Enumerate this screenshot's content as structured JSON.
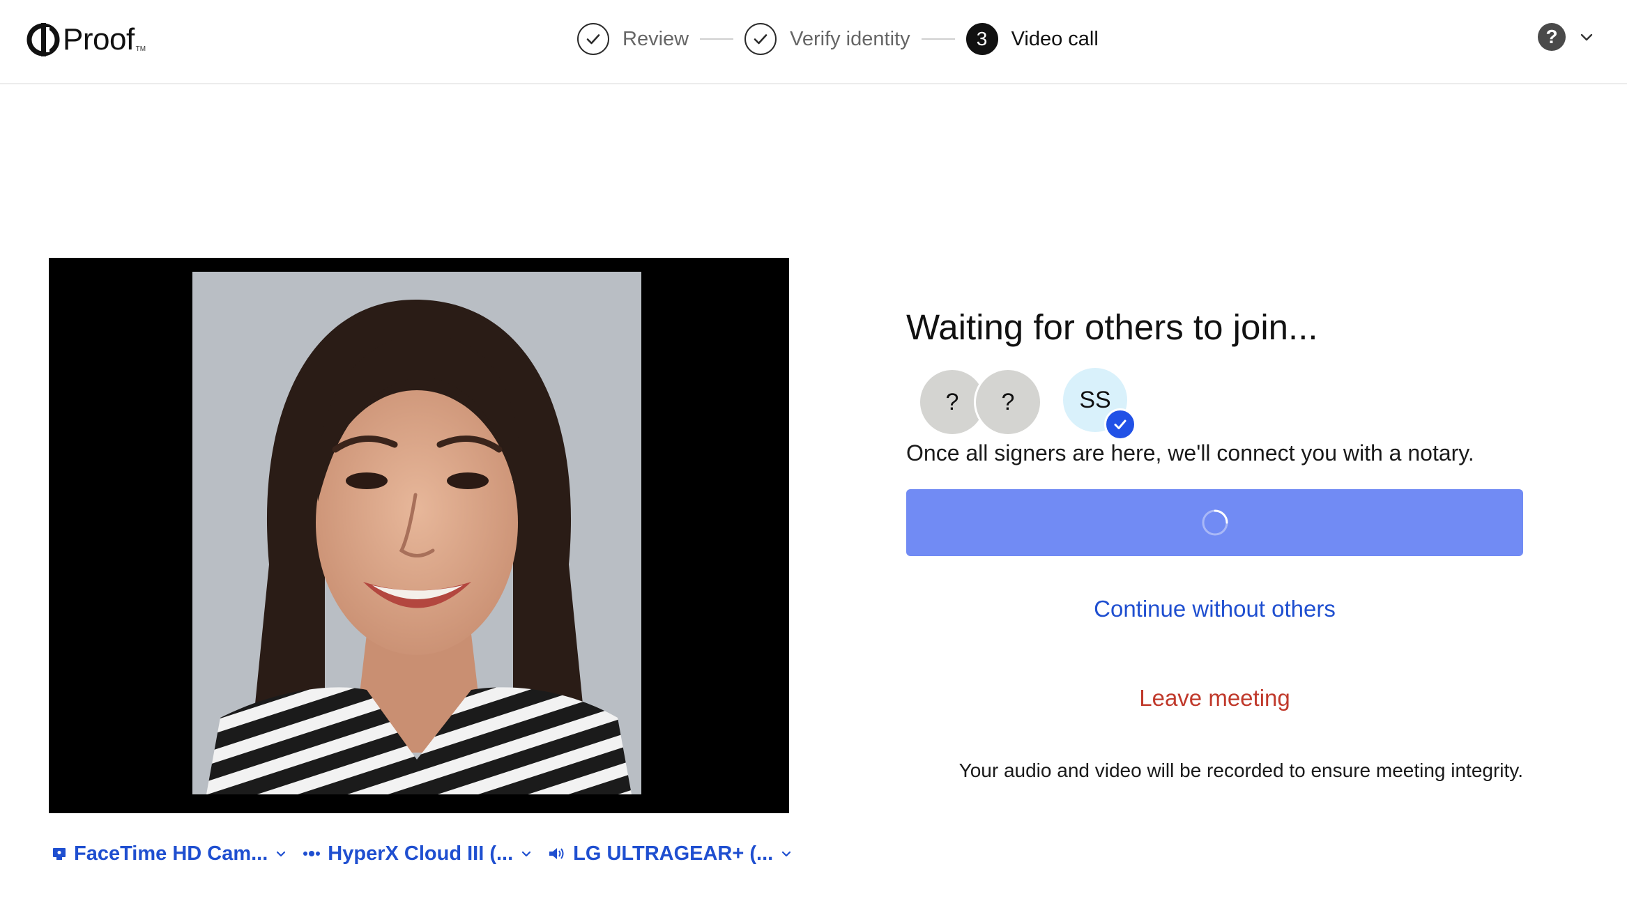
{
  "brand": {
    "name": "Proof",
    "tm": "TM"
  },
  "steps": [
    {
      "label": "Review",
      "state": "done"
    },
    {
      "label": "Verify identity",
      "state": "done"
    },
    {
      "label": "Video call",
      "state": "active",
      "number": "3"
    }
  ],
  "help": {
    "icon": "question-icon",
    "glyph": "?"
  },
  "waiting": {
    "title": "Waiting for others to join...",
    "avatars": [
      {
        "initials": "?",
        "status": "unknown"
      },
      {
        "initials": "?",
        "status": "unknown"
      },
      {
        "initials": "SS",
        "status": "joined"
      }
    ],
    "description": "Once all signers are here, we'll connect you with a notary.",
    "continue_label": "Continue without others",
    "leave_label": "Leave meeting",
    "recording_note": "Your audio and video will be recorded to ensure meeting integrity."
  },
  "devices": {
    "camera": "FaceTime HD Cam...",
    "microphone": "HyperX Cloud III (...",
    "speaker": "LG ULTRAGEAR+ (..."
  },
  "colors": {
    "accent": "#1f4fd0",
    "button_loading": "#718bf4",
    "danger": "#c0392b",
    "badge": "#2151e6"
  }
}
